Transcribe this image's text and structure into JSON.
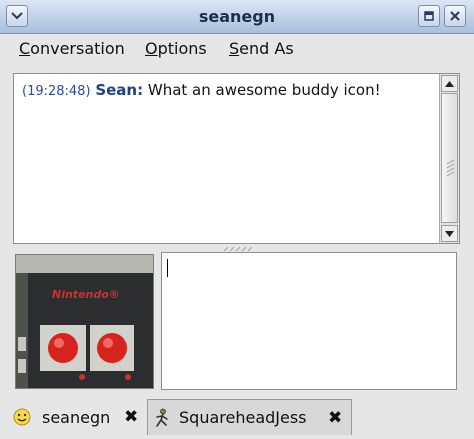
{
  "window": {
    "title": "seanegn"
  },
  "menu": [
    {
      "mnemonic": "C",
      "rest": "onversation"
    },
    {
      "mnemonic": "O",
      "rest": "ptions"
    },
    {
      "mnemonic": "S",
      "rest": "end As"
    }
  ],
  "conversation": {
    "messages": [
      {
        "timestamp": "(19:28:48)",
        "sender": "Sean:",
        "text": " What an awesome buddy icon!"
      }
    ]
  },
  "input": {
    "value": ""
  },
  "buddy_icon": {
    "lettering": "Nintendo®"
  },
  "tabs": [
    {
      "label": "seanegn",
      "icon": "smiley-icon",
      "active": true
    },
    {
      "label": "SquareheadJess",
      "icon": "running-buddy-icon",
      "active": false
    }
  ],
  "colors": {
    "timestamp": "#2b4a9a",
    "sender": "#20407e",
    "titlebar": "#a9bfdc"
  }
}
